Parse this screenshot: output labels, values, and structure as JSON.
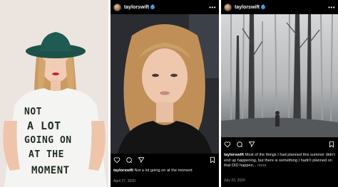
{
  "left": {
    "shirt_lines": [
      "NOT",
      "A LOT",
      "GOING ON",
      "AT THE",
      "MOMENT"
    ]
  },
  "mid": {
    "username": "taylorswift",
    "more_icon": "more-horizontal-icon",
    "caption_user": "taylorswift",
    "caption_text": "Not a lot going on at the moment",
    "date": "April 27, 2020"
  },
  "right": {
    "username": "taylorswift",
    "more_icon": "more-horizontal-icon",
    "caption_user": "taylorswift",
    "caption_text": "Most of the things I had planned this summer didn't end up happening, but there is something I hadn't planned on that DID happen...",
    "caption_more": "more",
    "date": "July 23, 2020"
  },
  "colors": {
    "verified": "#3897f0",
    "hat": "#1f5b52",
    "hair": "#c99a62"
  }
}
